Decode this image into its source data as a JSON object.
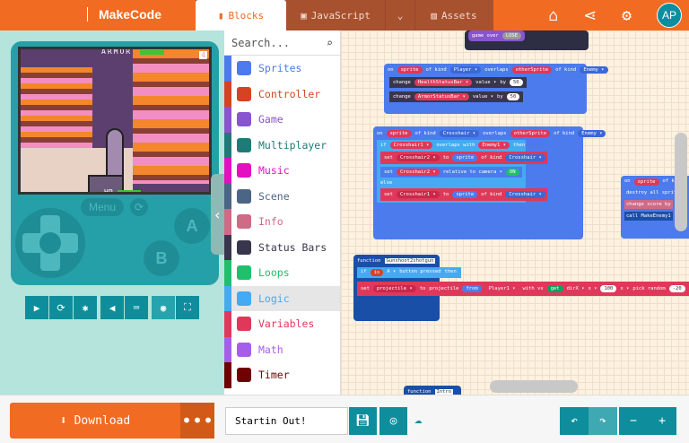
{
  "header": {
    "brand": "MakeCode",
    "tabs": [
      {
        "label": "Blocks"
      },
      {
        "label": "JavaScript"
      },
      {
        "label": "Assets"
      }
    ],
    "avatar": "AP"
  },
  "simulator": {
    "hud_armor": "ARMOR",
    "hud_hp": "HP",
    "score": "4",
    "menu": "Menu",
    "a": "A",
    "b": "B"
  },
  "toolbox": {
    "search_placeholder": "Search...",
    "categories": [
      {
        "label": "Sprites",
        "color": "#4b7bec"
      },
      {
        "label": "Controller",
        "color": "#d54322"
      },
      {
        "label": "Game",
        "color": "#8854d0"
      },
      {
        "label": "Multiplayer",
        "color": "#207a77"
      },
      {
        "label": "Music",
        "color": "#e30fc0"
      },
      {
        "label": "Scene",
        "color": "#4b6584"
      },
      {
        "label": "Info",
        "color": "#cf6a87"
      },
      {
        "label": "Status Bars",
        "color": "#38364d"
      },
      {
        "label": "Loops",
        "color": "#20bf6b"
      },
      {
        "label": "Logic",
        "color": "#45aaf2"
      },
      {
        "label": "Variables",
        "color": "#e0385a"
      },
      {
        "label": "Math",
        "color": "#a55eea"
      },
      {
        "label": "Timer",
        "color": "#700204"
      }
    ]
  },
  "blocks": {
    "gameover": [
      "game over",
      "LOSE"
    ],
    "ev1": [
      "on",
      "sprite",
      "of kind",
      "Player ▾",
      "overlaps",
      "otherSprite",
      "of kind",
      "Enemy ▾"
    ],
    "ch1": [
      "change",
      "HealthStatusBar ▾",
      "value ▾",
      "by",
      "50"
    ],
    "ch2": [
      "change",
      "ArmorStatusBar ▾",
      "value ▾",
      "by",
      "50"
    ],
    "ev2": [
      "on",
      "sprite",
      "of kind",
      "Crosshair ▾",
      "overlaps",
      "otherSprite",
      "of kind",
      "Enemy ▾"
    ],
    "if1": [
      "if",
      "Crosshair1 ▾",
      "overlaps with",
      "Enemy1 ▾",
      "then"
    ],
    "set1": [
      "set",
      "Crosshair2 ▾",
      "to",
      "sprite",
      "of kind",
      "Crosshair ▾"
    ],
    "set2": [
      "set",
      "Crosshair2 ▾",
      "relative to camera ▾",
      "ON"
    ],
    "else": "else",
    "set3": [
      "set",
      "Crosshair1 ▾",
      "to",
      "sprite",
      "of kind",
      "Crosshair ▾"
    ],
    "ev3": [
      "on",
      "sprite",
      "of kind"
    ],
    "destroy": "destroy all sprites",
    "score": "change score by",
    "call": "call MakeEnemy1",
    "fn1": [
      "function",
      "Gunshoot2shotgun"
    ],
    "if2": [
      "if",
      "is",
      "A ▾",
      "button pressed",
      "then"
    ],
    "proj": [
      "set",
      "projectile ▾",
      "to",
      "projectile",
      "from",
      "Player1 ▾",
      "with vx",
      "get",
      "dirX ▾",
      "x ▾",
      "100",
      "x ▾",
      "pick random",
      "-20"
    ],
    "fn2": [
      "function",
      "Intro"
    ]
  },
  "bottom": {
    "download": "Download",
    "project_name": "Startin Out!"
  }
}
